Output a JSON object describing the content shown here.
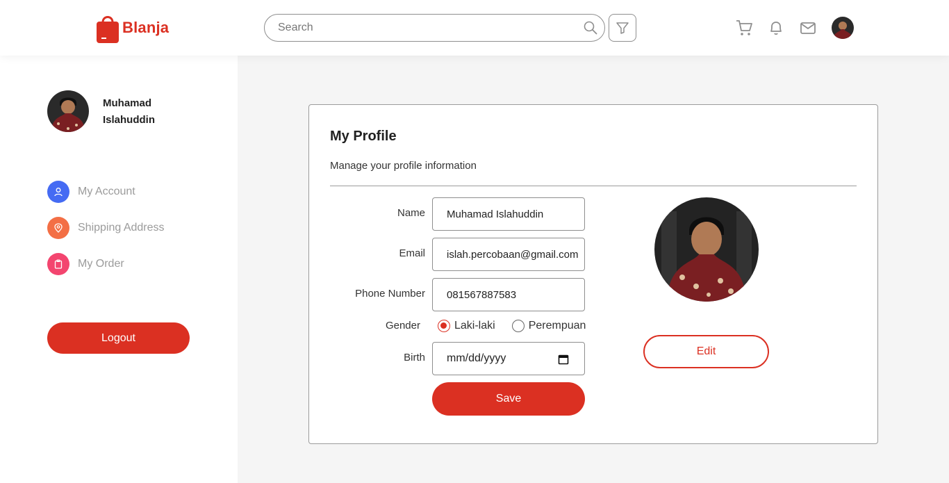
{
  "header": {
    "brand": "Blanja",
    "search_placeholder": "Search"
  },
  "sidebar": {
    "user_name": "Muhamad Islahuddin",
    "items": [
      {
        "label": "My Account",
        "icon": "user-icon",
        "color": "#456bf3"
      },
      {
        "label": "Shipping Address",
        "icon": "map-pin-icon",
        "color": "#f36f45"
      },
      {
        "label": "My Order",
        "icon": "clipboard-icon",
        "color": "#f3456f"
      }
    ],
    "logout_label": "Logout"
  },
  "profile": {
    "title": "My Profile",
    "subtitle": "Manage your profile information",
    "labels": {
      "name": "Name",
      "email": "Email",
      "phone": "Phone Number",
      "gender": "Gender",
      "birth": "Birth"
    },
    "values": {
      "name": "Muhamad Islahuddin",
      "email": "islah.percobaan@gmail.com",
      "phone": "081567887583",
      "birth_placeholder": "mm/dd/yyyy"
    },
    "gender_options": [
      {
        "label": "Laki-laki",
        "checked": true
      },
      {
        "label": "Perempuan",
        "checked": false
      }
    ],
    "save_label": "Save",
    "edit_label": "Edit"
  },
  "colors": {
    "accent": "#db3022"
  }
}
